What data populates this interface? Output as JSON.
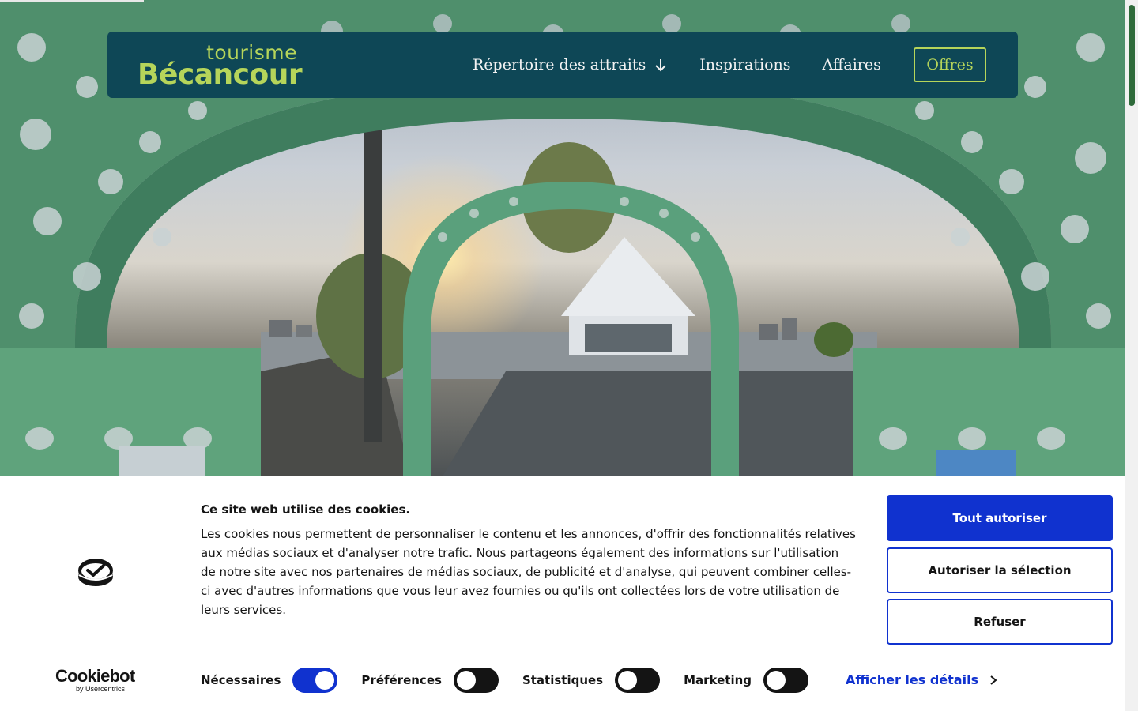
{
  "header": {
    "logo_small": "tourisme",
    "logo_big": "Bécancour",
    "nav_items": [
      {
        "label": "Répertoire des attraits",
        "icon": "arrow-down-icon"
      },
      {
        "label": "Inspirations"
      },
      {
        "label": "Affaires"
      }
    ],
    "offers_label": "Offres"
  },
  "colors": {
    "nav_bg": "#0e4756",
    "accent_green": "#b6d55a",
    "cookie_blue": "#1032cf"
  },
  "hero": {
    "image": "green-decorative-arch-with-sunset-and-white-tent"
  },
  "cookie_banner": {
    "title": "Ce site web utilise des cookies.",
    "body": "Les cookies nous permettent de personnaliser le contenu et les annonces, d'offrir des fonctionnalités relatives aux médias sociaux et d'analyser notre trafic. Nous partageons également des informations sur l'utilisation de notre site avec nos partenaires de médias sociaux, de publicité et d'analyse, qui peuvent combiner celles-ci avec d'autres informations que vous leur avez fournies ou qu'ils ont collectées lors de votre utilisation de leurs services.",
    "buttons": {
      "allow_all": "Tout autoriser",
      "allow_selection": "Autoriser la sélection",
      "refuse": "Refuser"
    },
    "toggles": [
      {
        "label": "Nécessaires",
        "state": "on"
      },
      {
        "label": "Préférences",
        "state": "off"
      },
      {
        "label": "Statistiques",
        "state": "off"
      },
      {
        "label": "Marketing",
        "state": "off"
      }
    ],
    "details_label": "Afficher les détails",
    "brand_name": "Cookiebot",
    "brand_by": "by Usercentrics"
  }
}
